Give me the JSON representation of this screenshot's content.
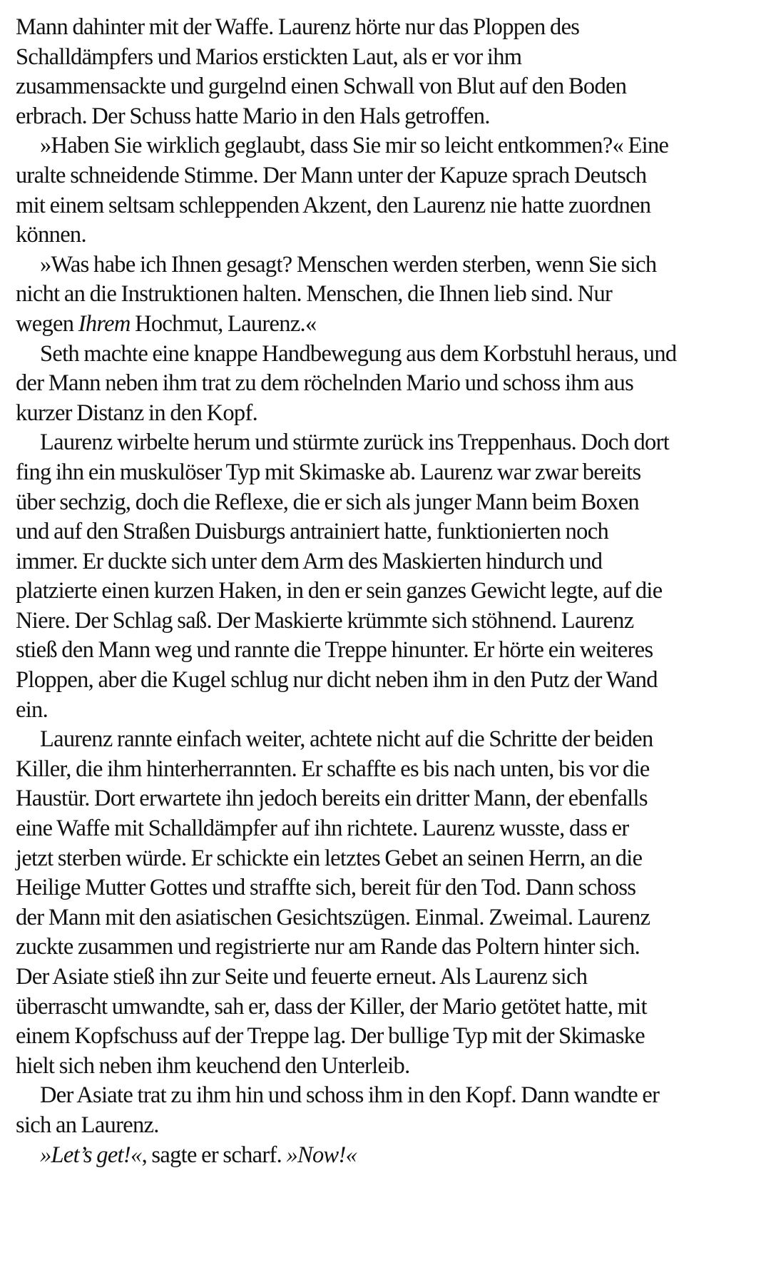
{
  "paragraphs": [
    {
      "lines": [
        [
          {
            "t": "Mann dahinter mit der Waffe. Laurenz hörte nur das Ploppen des"
          }
        ],
        [
          {
            "t": "Schalldämpfers und Marios erstickten Laut, als er vor ihm"
          }
        ],
        [
          {
            "t": "zusammensackte und gurgelnd einen Schwall von Blut auf den Boden"
          }
        ],
        [
          {
            "t": "erbrach. Der Schuss hatte Mario in den Hals getroffen."
          }
        ]
      ]
    },
    {
      "lines": [
        [
          {
            "t": "»Haben Sie wirklich geglaubt, dass Sie mir so leicht entkommen?« Eine"
          }
        ],
        [
          {
            "t": "uralte schneidende Stimme. Der Mann unter der Kapuze sprach Deutsch"
          }
        ],
        [
          {
            "t": "mit einem seltsam schleppenden Akzent, den Laurenz nie hatte zuordnen"
          }
        ],
        [
          {
            "t": "können."
          }
        ]
      ]
    },
    {
      "lines": [
        [
          {
            "t": "»Was habe ich Ihnen gesagt? Menschen werden sterben, wenn Sie sich"
          }
        ],
        [
          {
            "t": "nicht an die Instruktionen halten. Menschen, die Ihnen lieb sind. Nur"
          }
        ],
        [
          {
            "t": "wegen "
          },
          {
            "t": "Ihrem",
            "i": true
          },
          {
            "t": " Hochmut, Laurenz.«"
          }
        ]
      ]
    },
    {
      "lines": [
        [
          {
            "t": "Seth machte eine knappe Handbewegung aus dem Korbstuhl heraus, und"
          }
        ],
        [
          {
            "t": "der Mann neben ihm trat zu dem röchelnden Mario und schoss ihm aus"
          }
        ],
        [
          {
            "t": "kurzer Distanz in den Kopf."
          }
        ]
      ]
    },
    {
      "lines": [
        [
          {
            "t": "Laurenz wirbelte herum und stürmte zurück ins Treppenhaus. Doch dort"
          }
        ],
        [
          {
            "t": "fing ihn ein muskulöser Typ mit Skimaske ab. Laurenz war zwar bereits"
          }
        ],
        [
          {
            "t": "über sechzig, doch die Reflexe, die er sich als junger Mann beim Boxen"
          }
        ],
        [
          {
            "t": "und auf den Straßen Duisburgs antrainiert hatte, funktionierten noch"
          }
        ],
        [
          {
            "t": "immer. Er duckte sich unter dem Arm des Maskierten hindurch und"
          }
        ],
        [
          {
            "t": "platzierte einen kurzen Haken, in den er sein ganzes Gewicht legte, auf die"
          }
        ],
        [
          {
            "t": "Niere. Der Schlag saß. Der Maskierte krümmte sich stöhnend. Laurenz"
          }
        ],
        [
          {
            "t": "stieß den Mann weg und rannte die Treppe hinunter. Er hörte ein weiteres"
          }
        ],
        [
          {
            "t": "Ploppen, aber die Kugel schlug nur dicht neben ihm in den Putz der Wand"
          }
        ],
        [
          {
            "t": "ein."
          }
        ]
      ]
    },
    {
      "lines": [
        [
          {
            "t": "Laurenz rannte einfach weiter, achtete nicht auf die Schritte der beiden"
          }
        ],
        [
          {
            "t": "Killer, die ihm hinterherrannten. Er schaffte es bis nach unten, bis vor die"
          }
        ],
        [
          {
            "t": "Haustür. Dort erwartete ihn jedoch bereits ein dritter Mann, der ebenfalls"
          }
        ],
        [
          {
            "t": "eine Waffe mit Schalldämpfer auf ihn richtete. Laurenz wusste, dass er"
          }
        ],
        [
          {
            "t": "jetzt sterben würde. Er schickte ein letztes Gebet an seinen Herrn, an die"
          }
        ],
        [
          {
            "t": "Heilige Mutter Gottes und straffte sich, bereit für den Tod. Dann schoss"
          }
        ],
        [
          {
            "t": "der Mann mit den asiatischen Gesichtszügen. Einmal. Zweimal. Laurenz"
          }
        ],
        [
          {
            "t": "zuckte zusammen und registrierte nur am Rande das Poltern hinter sich."
          }
        ],
        [
          {
            "t": "Der Asiate stieß ihn zur Seite und feuerte erneut. Als Laurenz sich"
          }
        ],
        [
          {
            "t": "überrascht umwandte, sah er, dass der Killer, der Mario getötet hatte, mit"
          }
        ],
        [
          {
            "t": "einem Kopfschuss auf der Treppe lag. Der bullige Typ mit der Skimaske"
          }
        ],
        [
          {
            "t": "hielt sich neben ihm keuchend den Unterleib."
          }
        ]
      ]
    },
    {
      "lines": [
        [
          {
            "t": "Der Asiate trat zu ihm hin und schoss ihm in den Kopf. Dann wandte er"
          }
        ],
        [
          {
            "t": "sich an Laurenz."
          }
        ]
      ]
    },
    {
      "lines": [
        [
          {
            "t": "»Let’s get!«",
            "i": true
          },
          {
            "t": ", sagte er scharf. "
          },
          {
            "t": "»Now!«",
            "i": true
          }
        ]
      ]
    }
  ]
}
